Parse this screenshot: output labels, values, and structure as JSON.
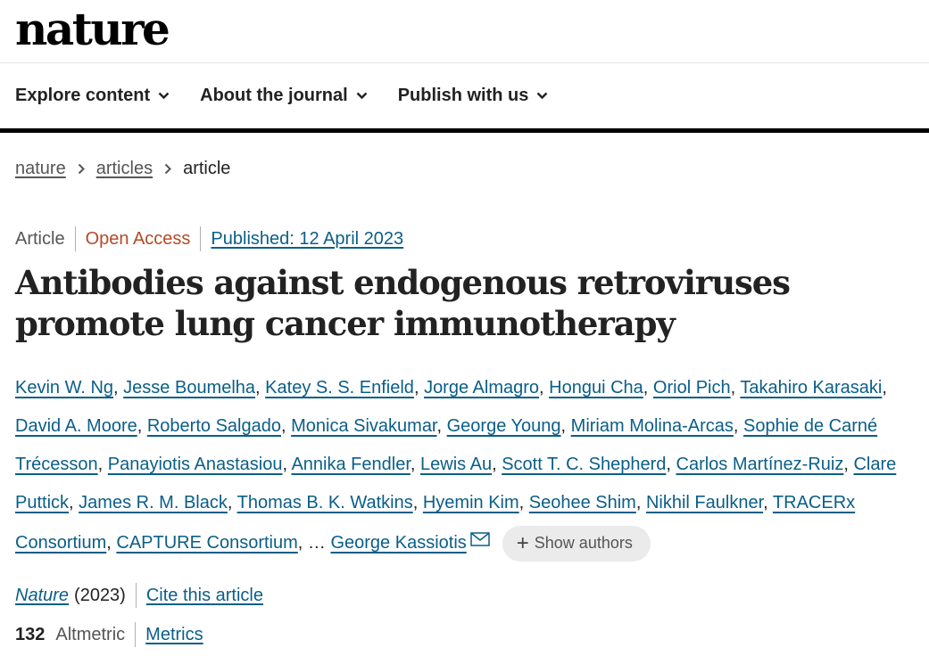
{
  "header": {
    "logo": "nature"
  },
  "nav": {
    "items": [
      {
        "label": "Explore content"
      },
      {
        "label": "About the journal"
      },
      {
        "label": "Publish with us"
      }
    ]
  },
  "breadcrumb": {
    "root": "nature",
    "section": "articles",
    "current": "article"
  },
  "article": {
    "type": "Article",
    "access": "Open Access",
    "published": "Published: 12 April 2023",
    "title": "Antibodies against endogenous retroviruses promote lung cancer immunotherapy",
    "authors": [
      "Kevin W. Ng",
      "Jesse Boumelha",
      "Katey S. S. Enfield",
      "Jorge Almagro",
      "Hongui Cha",
      "Oriol Pich",
      "Takahiro Karasaki",
      "David A. Moore",
      "Roberto Salgado",
      "Monica Sivakumar",
      "George Young",
      "Miriam Molina-Arcas",
      "Sophie de Carné Trécesson",
      "Panayiotis Anastasiou",
      "Annika Fendler",
      "Lewis Au",
      "Scott T. C. Shepherd",
      "Carlos Martínez-Ruiz",
      "Clare Puttick",
      "James R. M. Black",
      "Thomas B. K. Watkins",
      "Hyemin Kim",
      "Seohee Shim",
      "Nikhil Faulkner",
      "TRACERx Consortium",
      "CAPTURE Consortium"
    ],
    "ellipsis": "…",
    "last_author": "George Kassiotis",
    "show_authors": "Show authors",
    "journal": "Nature",
    "year": "(2023)",
    "cite": "Cite this article",
    "altmetric_count": "132",
    "altmetric_label": "Altmetric",
    "metrics": "Metrics"
  },
  "colors": {
    "link": "#0a5e88",
    "open_access": "#b34a26",
    "text": "#222222"
  }
}
